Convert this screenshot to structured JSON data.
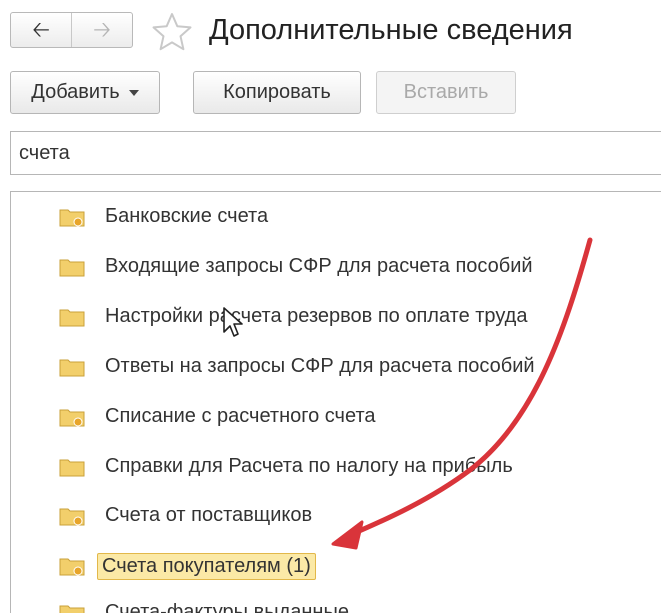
{
  "header": {
    "back_icon": "arrow-left-icon",
    "forward_icon": "arrow-right-icon",
    "favorite_icon": "star-outline-icon",
    "title": "Дополнительные сведения"
  },
  "toolbar": {
    "add_label": "Добавить",
    "copy_label": "Копировать",
    "paste_label": "Вставить"
  },
  "search": {
    "value": "счета"
  },
  "list": {
    "items": [
      {
        "label": "Банковские счета",
        "icon": "folder-icon",
        "dot": true
      },
      {
        "label": "Входящие запросы СФР для расчета пособий",
        "icon": "folder-icon",
        "dot": false
      },
      {
        "label": "Настройки расчета резервов по оплате труда",
        "icon": "folder-icon",
        "dot": false
      },
      {
        "label": "Ответы на запросы СФР для расчета пособий",
        "icon": "folder-icon",
        "dot": false
      },
      {
        "label": "Списание с расчетного счета",
        "icon": "folder-icon",
        "dot": true
      },
      {
        "label": "Справки для Расчета по налогу на прибыль",
        "icon": "folder-icon",
        "dot": false
      },
      {
        "label": "Счета от поставщиков",
        "icon": "folder-icon",
        "dot": true
      },
      {
        "label": "Счета покупателям (1)",
        "icon": "folder-icon",
        "dot": true,
        "selected": true
      },
      {
        "label": "Счета-фактуры выданные",
        "icon": "folder-icon",
        "dot": true
      }
    ]
  },
  "colors": {
    "selection_fill": "#fbe9a6",
    "selection_border": "#e2b84a",
    "arrow": "#d9343a",
    "folder": "#f2cf6b"
  }
}
